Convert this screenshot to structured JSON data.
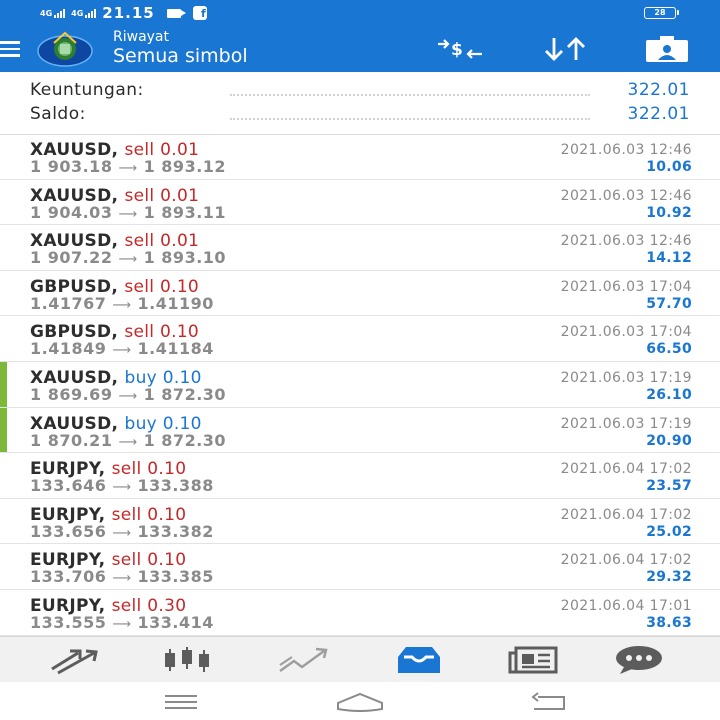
{
  "status_bar": {
    "network1": "4G",
    "network2": "4G",
    "time": "21.15",
    "battery": "28",
    "icons": [
      "video-icon",
      "facebook-icon"
    ]
  },
  "app_bar": {
    "subtitle": "Riwayat",
    "title": "Semua simbol",
    "icons": [
      "menu-icon",
      "metatrader-logo",
      "currency-filter-icon",
      "sort-icon",
      "account-icon"
    ]
  },
  "summary": {
    "profit_label": "Keuntungan:",
    "profit_value": "322.01",
    "balance_label": "Saldo:",
    "balance_value": "322.01"
  },
  "trades": [
    {
      "symbol": "XAUUSD,",
      "type": "sell",
      "volume": "0.01",
      "open": "1 903.18",
      "close": "1 893.12",
      "time": "2021.06.03 12:46",
      "profit": "10.06"
    },
    {
      "symbol": "XAUUSD,",
      "type": "sell",
      "volume": "0.01",
      "open": "1 904.03",
      "close": "1 893.11",
      "time": "2021.06.03 12:46",
      "profit": "10.92"
    },
    {
      "symbol": "XAUUSD,",
      "type": "sell",
      "volume": "0.01",
      "open": "1 907.22",
      "close": "1 893.10",
      "time": "2021.06.03 12:46",
      "profit": "14.12"
    },
    {
      "symbol": "GBPUSD,",
      "type": "sell",
      "volume": "0.10",
      "open": "1.41767",
      "close": "1.41190",
      "time": "2021.06.03 17:04",
      "profit": "57.70"
    },
    {
      "symbol": "GBPUSD,",
      "type": "sell",
      "volume": "0.10",
      "open": "1.41849",
      "close": "1.41184",
      "time": "2021.06.03 17:04",
      "profit": "66.50"
    },
    {
      "symbol": "XAUUSD,",
      "type": "buy",
      "volume": "0.10",
      "open": "1 869.69",
      "close": "1 872.30",
      "time": "2021.06.03 17:19",
      "profit": "26.10"
    },
    {
      "symbol": "XAUUSD,",
      "type": "buy",
      "volume": "0.10",
      "open": "1 870.21",
      "close": "1 872.30",
      "time": "2021.06.03 17:19",
      "profit": "20.90"
    },
    {
      "symbol": "EURJPY,",
      "type": "sell",
      "volume": "0.10",
      "open": "133.646",
      "close": "133.388",
      "time": "2021.06.04 17:02",
      "profit": "23.57"
    },
    {
      "symbol": "EURJPY,",
      "type": "sell",
      "volume": "0.10",
      "open": "133.656",
      "close": "133.382",
      "time": "2021.06.04 17:02",
      "profit": "25.02"
    },
    {
      "symbol": "EURJPY,",
      "type": "sell",
      "volume": "0.10",
      "open": "133.706",
      "close": "133.385",
      "time": "2021.06.04 17:02",
      "profit": "29.32"
    },
    {
      "symbol": "EURJPY,",
      "type": "sell",
      "volume": "0.30",
      "open": "133.555",
      "close": "133.414",
      "time": "2021.06.04 17:01",
      "profit": "38.63"
    }
  ],
  "bottom_nav": {
    "items": [
      "quotes-icon",
      "chart-icon",
      "trade-icon",
      "history-icon",
      "news-icon",
      "chat-icon"
    ],
    "active": "history-icon"
  },
  "system_nav": [
    "recent-apps-icon",
    "home-icon",
    "back-icon"
  ],
  "colors": {
    "primary": "#1976d2",
    "sell": "#c62828",
    "buy_marker": "#7cb83a",
    "muted": "#8a8a8a"
  }
}
